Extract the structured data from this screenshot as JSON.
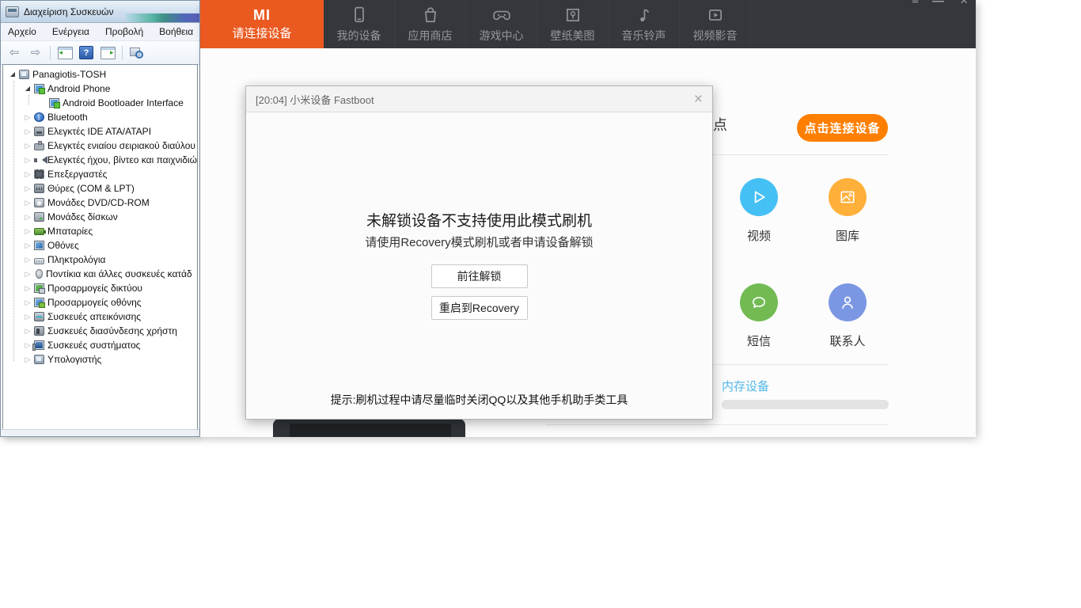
{
  "device_manager": {
    "title": "Διαχείριση Συσκευών",
    "menu": [
      "Αρχείο",
      "Ενέργεια",
      "Προβολή",
      "Βοήθεια"
    ],
    "tree": [
      {
        "label": "Panagiotis-TOSH",
        "indent": 0,
        "expander": "expanded",
        "icon": "computer-icon"
      },
      {
        "label": "Android Phone",
        "indent": 1,
        "expander": "expanded",
        "icon": "android-device-icon"
      },
      {
        "label": "Android Bootloader Interface",
        "indent": 2,
        "expander": "none",
        "icon": "android-device-icon"
      },
      {
        "label": "Bluetooth",
        "indent": 1,
        "expander": "collapsed",
        "icon": "bluetooth-icon"
      },
      {
        "label": "Ελεγκτές IDE ATA/ATAPI",
        "indent": 1,
        "expander": "collapsed",
        "icon": "ide-controller-icon"
      },
      {
        "label": "Ελεγκτές ενιαίου σειριακού διαύλου",
        "indent": 1,
        "expander": "collapsed",
        "icon": "usb-controller-icon"
      },
      {
        "label": "Ελεγκτές ήχου, βίντεο και παιχνιδιώ",
        "indent": 1,
        "expander": "collapsed",
        "icon": "audio-icon"
      },
      {
        "label": "Επεξεργαστές",
        "indent": 1,
        "expander": "collapsed",
        "icon": "processor-icon"
      },
      {
        "label": "Θύρες (COM & LPT)",
        "indent": 1,
        "expander": "collapsed",
        "icon": "ports-icon"
      },
      {
        "label": "Μονάδες DVD/CD-ROM",
        "indent": 1,
        "expander": "collapsed",
        "icon": "dvd-icon"
      },
      {
        "label": "Μονάδες δίσκων",
        "indent": 1,
        "expander": "collapsed",
        "icon": "disk-icon"
      },
      {
        "label": "Μπαταρίες",
        "indent": 1,
        "expander": "collapsed",
        "icon": "battery-icon"
      },
      {
        "label": "Οθόνες",
        "indent": 1,
        "expander": "collapsed",
        "icon": "monitor-icon"
      },
      {
        "label": "Πληκτρολόγια",
        "indent": 1,
        "expander": "collapsed",
        "icon": "keyboard-icon"
      },
      {
        "label": "Ποντίκια και άλλες συσκευές κατάδ",
        "indent": 1,
        "expander": "collapsed",
        "icon": "mouse-icon"
      },
      {
        "label": "Προσαρμογείς δικτύου",
        "indent": 1,
        "expander": "collapsed",
        "icon": "network-icon"
      },
      {
        "label": "Προσαρμογείς οθόνης",
        "indent": 1,
        "expander": "collapsed",
        "icon": "display-adapter-icon"
      },
      {
        "label": "Συσκευές απεικόνισης",
        "indent": 1,
        "expander": "collapsed",
        "icon": "imaging-icon"
      },
      {
        "label": "Συσκευές διασύνδεσης χρήστη",
        "indent": 1,
        "expander": "collapsed",
        "icon": "hid-icon"
      },
      {
        "label": "Συσκευές συστήματος",
        "indent": 1,
        "expander": "collapsed",
        "icon": "system-icon"
      },
      {
        "label": "Υπολογιστής",
        "indent": 1,
        "expander": "collapsed",
        "icon": "computer2-icon"
      }
    ]
  },
  "mi_app": {
    "logo": "MI",
    "active_tab_label": "请连接设备",
    "nav": [
      {
        "label": "我的设备",
        "icon": "phone-icon"
      },
      {
        "label": "应用商店",
        "icon": "shop-bag-icon"
      },
      {
        "label": "游戏中心",
        "icon": "gamepad-icon"
      },
      {
        "label": "壁纸美图",
        "icon": "wallpaper-icon"
      },
      {
        "label": "音乐铃声",
        "icon": "music-note-icon"
      },
      {
        "label": "视频影音",
        "icon": "video-icon"
      }
    ],
    "partial_heading_text": "点",
    "connect_button_label": "点击连接设备",
    "home_shortcuts": [
      {
        "label": "视频",
        "color": "#45c0f5",
        "glyph": "play-icon"
      },
      {
        "label": "图库",
        "color": "#ffb03a",
        "glyph": "image-icon"
      },
      {
        "label": "短信",
        "color": "#72bb53",
        "glyph": "message-icon"
      },
      {
        "label": "联系人",
        "color": "#7b97e3",
        "glyph": "contact-icon"
      }
    ],
    "storage_section_label": "内存设备",
    "colors": {
      "header_bg": "#34373c",
      "active_tab_orange": "#ea5a20",
      "connect_button_orange": "#ff7f00",
      "storage_label_blue": "#53b7e8"
    }
  },
  "dialog": {
    "title": "[20:04] 小米设备 Fastboot",
    "heading": "未解锁设备不支持使用此模式刷机",
    "subheading": "请使用Recovery模式刷机或者申请设备解锁",
    "buttons": [
      "前往解锁",
      "重启到Recovery"
    ],
    "hint": "提示:刷机过程中请尽量临时关闭QQ以及其他手机助手类工具"
  }
}
